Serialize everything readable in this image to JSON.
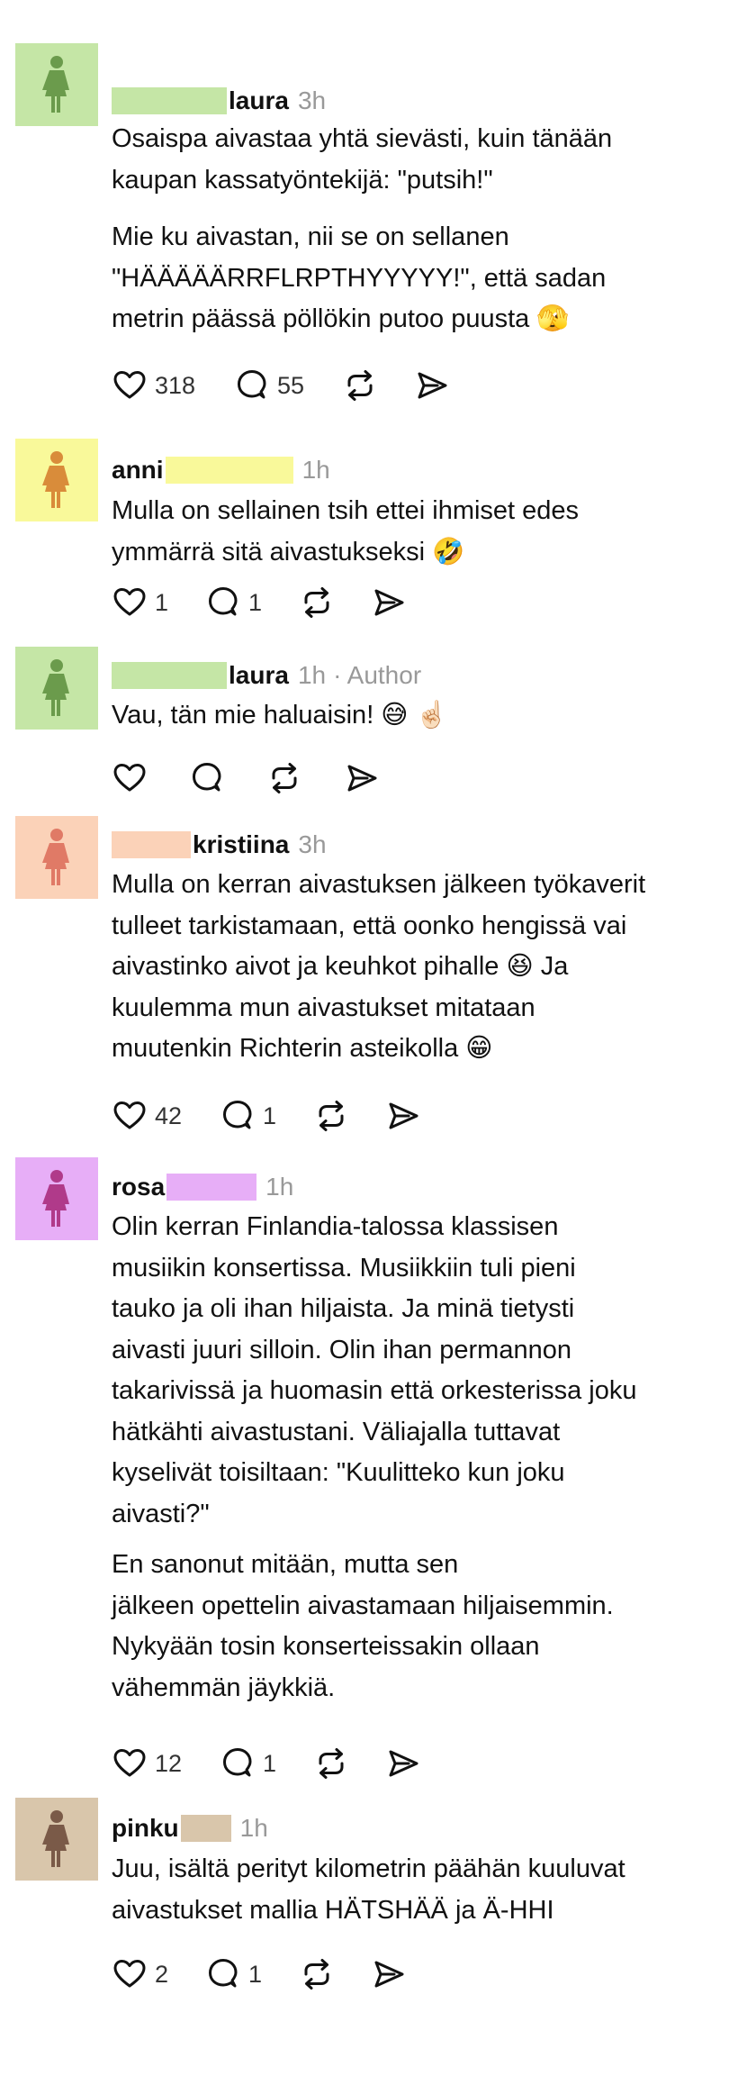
{
  "posts": [
    {
      "username": "laura",
      "time": "3h",
      "meta": "",
      "avatar_color": "#c5e6a6",
      "figure_color": "#6b9b4c",
      "redact_color": "#c5e6a6",
      "paragraphs": [
        [
          "Osaispa aivastaa yhtä sievästi, kuin tänään",
          "kaupan kassatyöntekijä: \"putsih!\""
        ],
        [
          "Mie ku aivastan, nii se on sellanen",
          "\"HÄÄÄÄÄRRFLRPTHYYYYY!\", että sadan",
          "metrin päässä pöllökin putoo puusta 🫣"
        ]
      ],
      "likes": "318",
      "replies": "55"
    },
    {
      "username": "anni",
      "time": "1h",
      "meta": "",
      "avatar_color": "#f9f99a",
      "figure_color": "#d98c3a",
      "redact_color": "#f9f99a",
      "paragraphs": [
        [
          "Mulla on sellainen tsih ettei ihmiset edes",
          "ymmärrä sitä aivastukseksi 🤣"
        ]
      ],
      "likes": "1",
      "replies": "1"
    },
    {
      "username": "laura",
      "time": "1h",
      "meta": "· Author",
      "avatar_color": "#c5e6a6",
      "figure_color": "#6b9b4c",
      "redact_color": "#c5e6a6",
      "paragraphs": [
        [
          "Vau, tän mie haluaisin! 😅 ☝🏻"
        ]
      ],
      "likes": "",
      "replies": ""
    },
    {
      "username": "kristiina",
      "time": "3h",
      "meta": "",
      "avatar_color": "#fbd2b8",
      "figure_color": "#e07a66",
      "redact_color": "#fbd2b8",
      "paragraphs": [
        [
          "Mulla on kerran aivastuksen jälkeen työkaverit",
          "tulleet tarkistamaan, että oonko hengissä vai",
          "aivastinko aivot ja keuhkot pihalle 😆 Ja",
          "kuulemma mun aivastukset mitataan",
          "muutenkin Richterin asteikolla 😁"
        ]
      ],
      "likes": "42",
      "replies": "1"
    },
    {
      "username": "rosa",
      "time": "1h",
      "meta": "",
      "avatar_color": "#e7aef7",
      "figure_color": "#b03a8a",
      "redact_color": "#e7aef7",
      "paragraphs": [
        [
          "Olin kerran Finlandia-talossa klassisen",
          "musiikin konsertissa. Musiikkiin tuli pieni",
          "tauko ja oli ihan hiljaista. Ja minä tietysti",
          "aivasti juuri silloin. Olin ihan permannon",
          "takarivissä ja huomasin että orkesterissa joku",
          "hätkähti aivastustani. Väliajalla tuttavat",
          "kyselivät toisiltaan: \"Kuulitteko kun joku",
          "aivasti?\""
        ],
        [
          "En sanonut mitään, mutta sen",
          "jälkeen opettelin aivastamaan hiljaisemmin.",
          "Nykyään tosin konserteissakin ollaan",
          "vähemmän jäykkiä."
        ]
      ],
      "likes": "12",
      "replies": "1"
    },
    {
      "username": "pinku",
      "time": "1h",
      "meta": "",
      "avatar_color": "#d9c6ab",
      "figure_color": "#7a5a48",
      "redact_color": "#d9c6ab",
      "paragraphs": [
        [
          "Juu, isältä perityt kilometrin päähän kuuluvat",
          "aivastukset mallia HÄTSHÄÄ ja Ä-HHI"
        ]
      ],
      "likes": "2",
      "replies": "1"
    }
  ],
  "icons": {
    "like": "heart-icon",
    "reply": "comment-icon",
    "repost": "repost-icon",
    "share": "share-icon"
  }
}
